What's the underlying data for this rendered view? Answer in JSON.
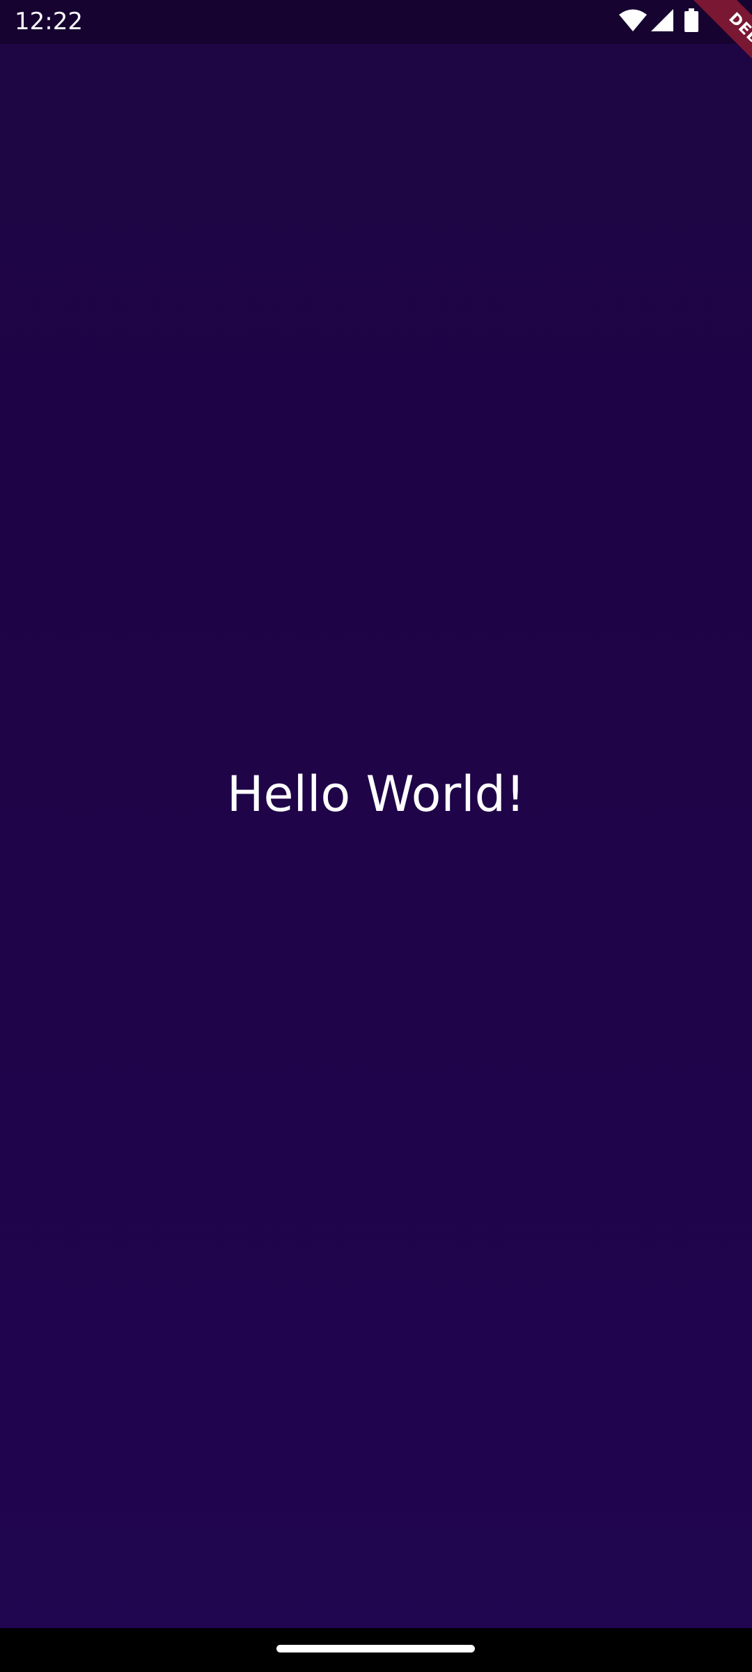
{
  "status_bar": {
    "time": "12:22",
    "icons": [
      "wifi-icon",
      "cellular-signal-icon",
      "battery-icon"
    ]
  },
  "debug_banner": {
    "label": "DEBUG",
    "color": "#7a1732"
  },
  "main": {
    "text": "Hello World!"
  },
  "colors": {
    "background": "#1f044a",
    "status_bar": "#160330",
    "text": "#ffffff",
    "nav_bar": "#000000"
  }
}
